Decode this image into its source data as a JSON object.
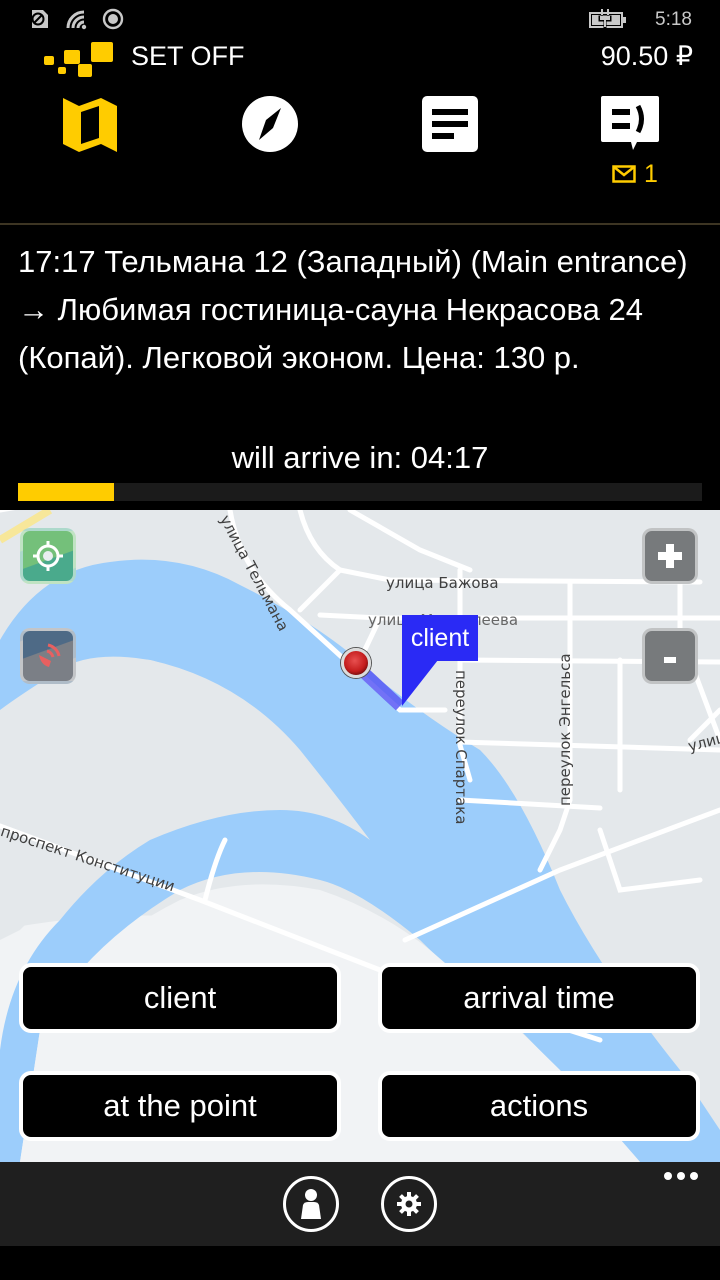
{
  "status_bar": {
    "time": "5:18",
    "icons": [
      "sim-blocked-icon",
      "wifi-icon",
      "location-icon",
      "battery-charging-icon"
    ]
  },
  "header": {
    "status_title": "SET OFF",
    "balance": "90.50 ₽"
  },
  "nav": {
    "items": [
      {
        "name": "map",
        "icon": "map-icon",
        "active": true
      },
      {
        "name": "navigator",
        "icon": "compass-icon",
        "active": false
      },
      {
        "name": "orders",
        "icon": "list-icon",
        "active": false
      },
      {
        "name": "chat",
        "icon": "chat-icon",
        "active": false
      }
    ],
    "unread_messages": "1"
  },
  "order": {
    "description": "17:17 Тельмана 12 (Западный) (Main entrance) → Любимая гостиница-сауна Некрасова 24 (Копай). Легковой эконом. Цена: 130 р.",
    "arrival_label": "will arrive in: 04:17",
    "progress_fraction": 0.14
  },
  "map": {
    "client_marker_label": "client",
    "street_labels": [
      "улица Тельмана",
      "улица Бажова",
      "улица Менделеева",
      "переулок Спартака",
      "переулок Энгельса",
      "проспект Конституции",
      "улица"
    ],
    "zoom_in_label": "+",
    "zoom_out_label": "-"
  },
  "actions": {
    "client": "client",
    "arrival_time": "arrival time",
    "at_the_point": "at the point",
    "actions": "actions"
  },
  "colors": {
    "accent": "#ffcc00",
    "route": "#2a2af5",
    "water": "#9ccdfb",
    "land": "#e4e8eb"
  }
}
